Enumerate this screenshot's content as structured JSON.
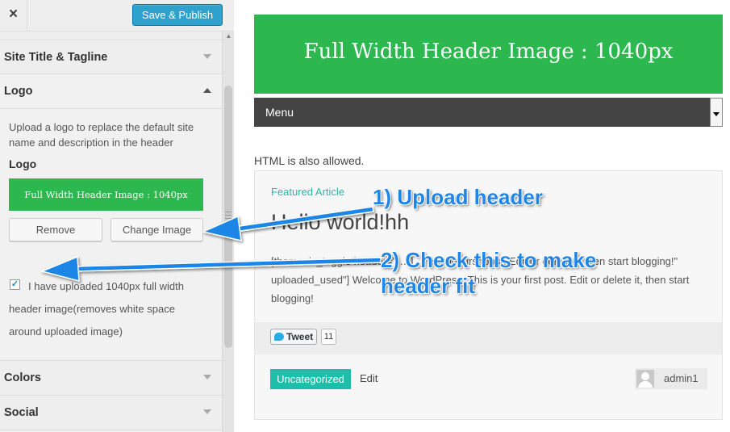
{
  "topbar": {
    "close_icon": "×",
    "publish_label": "Save & Publish"
  },
  "sections": {
    "site_title": "Site Title & Tagline",
    "logo": "Logo",
    "colors": "Colors",
    "social": "Social"
  },
  "logo_panel": {
    "description": "Upload a logo to replace the default site name and description in the header",
    "label": "Logo",
    "preview_text": "Full Width Header Image : 1040px",
    "remove_label": "Remove",
    "change_label": "Change Image",
    "checkbox_checked": true,
    "checkbox_label": "I have uploaded 1040px full width header image(removes white space around uploaded image)"
  },
  "preview": {
    "header_text": "Full Width Header Image : 1040px",
    "menu_label": "Menu",
    "html_note": "HTML is also allowed.",
    "post": {
      "category_top": "Featured Article",
      "title": "Hello world!hh",
      "body": "[themonic_toggle header=\"…\"] … is your first post. Edit or delete it, then start blogging!\" uploaded_used\"]  Welcome to WordPress. This is your first post. Edit or delete it, then start blogging!",
      "tweet_label": "Tweet",
      "tweet_count": "11",
      "category_badge": "Uncategorized",
      "edit_label": "Edit",
      "author": "admin1"
    }
  },
  "annotations": {
    "step1": "1) Upload header",
    "step2_line1": "2) Check this to make",
    "step2_line2": "header fit",
    "color": "#1f86e8"
  },
  "colors": {
    "accent_green": "#2db74f",
    "publish_blue": "#2ea2cc",
    "teal": "#1fbeaa",
    "menu_dark": "#444444"
  }
}
